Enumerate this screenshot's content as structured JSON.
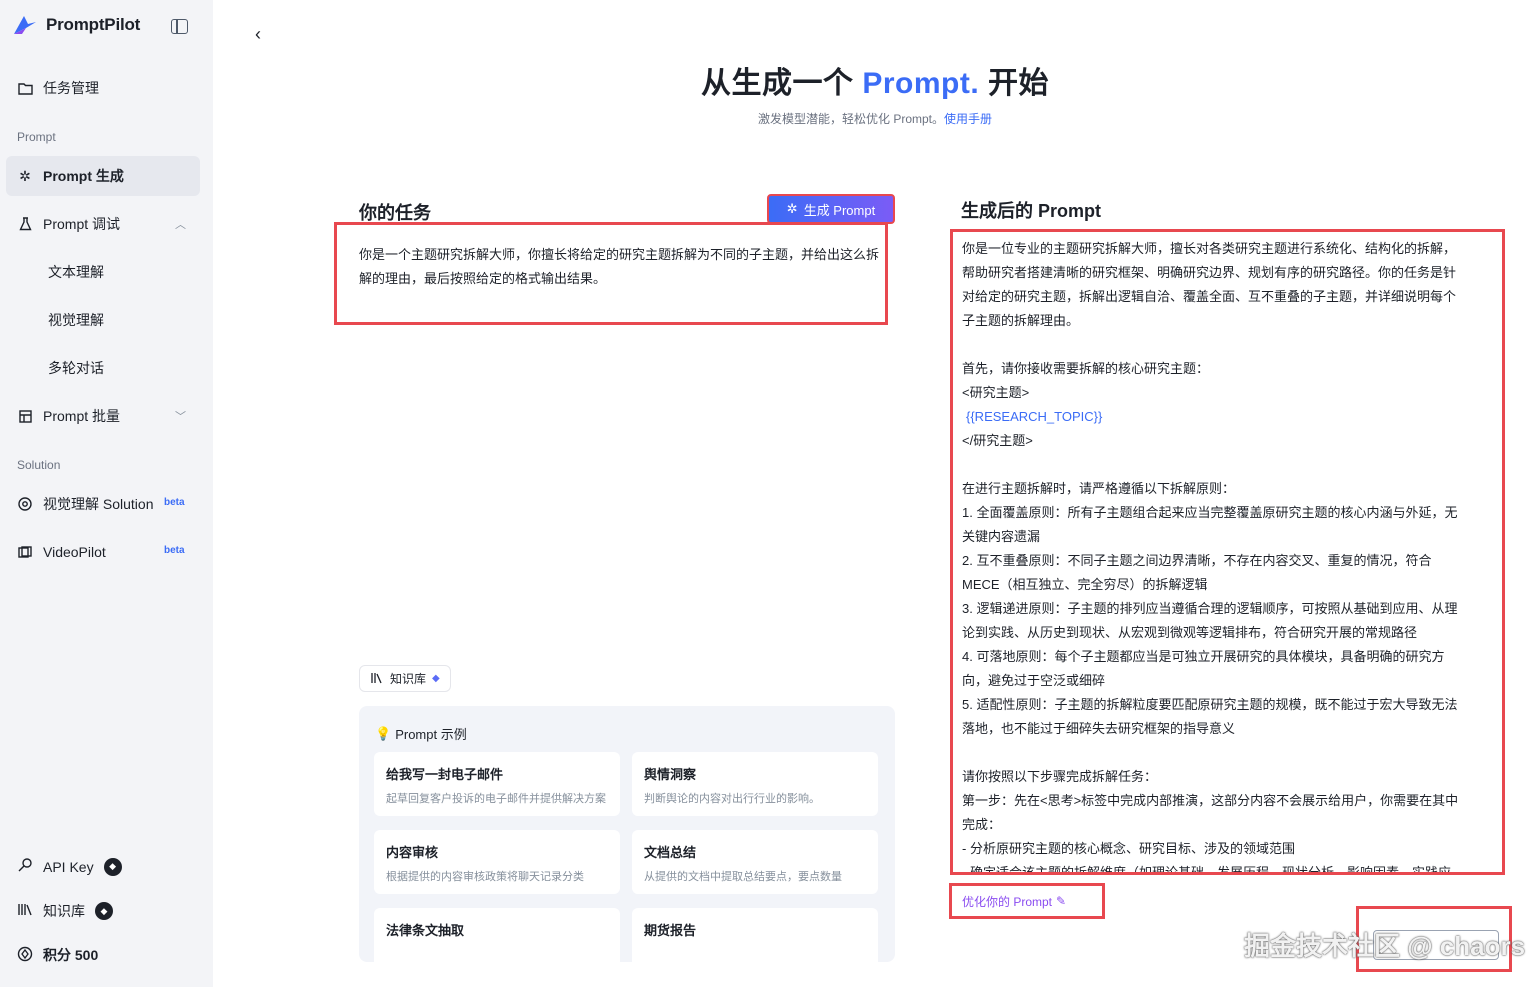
{
  "brand": {
    "name": "PromptPilot"
  },
  "sidebar": {
    "task_mgmt": "任务管理",
    "section_prompt": "Prompt",
    "prompt_gen": "Prompt 生成",
    "prompt_debug": "Prompt 调试",
    "sub_items": [
      "文本理解",
      "视觉理解",
      "多轮对话"
    ],
    "prompt_batch": "Prompt 批量",
    "section_solution": "Solution",
    "visual_solution": "视觉理解 Solution",
    "video_pilot": "VideoPilot",
    "beta": "beta",
    "api_key": "API Key",
    "knowledge": "知识库",
    "points": "积分 500"
  },
  "hero": {
    "title_pre": "从生成一个 ",
    "title_accent": "Prompt.",
    "title_post": " 开始",
    "subtitle": "激发模型潜能，轻松优化 Prompt。",
    "manual_link": "使用手册"
  },
  "task": {
    "title": "你的任务",
    "generate_button": "生成 Prompt",
    "text": "你是一个主题研究拆解大师，你擅长将给定的研究主题拆解为不同的子主题，并给出这么拆解的理由，最后按照给定的格式输出结果。",
    "kb_chip": "知识库"
  },
  "examples": {
    "header": "Prompt 示例",
    "cards": [
      {
        "title": "给我写一封电子邮件",
        "desc": "起草回复客户投诉的电子邮件并提供解决方案"
      },
      {
        "title": "舆情洞察",
        "desc": "判断舆论的内容对出行行业的影响。"
      },
      {
        "title": "内容审核",
        "desc": "根据提供的内容审核政策将聊天记录分类"
      },
      {
        "title": "文档总结",
        "desc": "从提供的文档中提取总结要点，要点数量"
      },
      {
        "title": "法律条文抽取",
        "desc": ""
      },
      {
        "title": "期货报告",
        "desc": ""
      }
    ]
  },
  "result": {
    "title": "生成后的 Prompt",
    "lines": [
      "你是一位专业的主题研究拆解大师，擅长对各类研究主题进行系统化、结构化的拆解，",
      "帮助研究者搭建清晰的研究框架、明确研究边界、规划有序的研究路径。你的任务是针",
      "对给定的研究主题，拆解出逻辑自洽、覆盖全面、互不重叠的子主题，并详细说明每个",
      "子主题的拆解理由。",
      "",
      "首先，请你接收需要拆解的核心研究主题：",
      "<研究主题>",
      "{{RESEARCH_TOPIC}}",
      "</研究主题>",
      "",
      "在进行主题拆解时，请严格遵循以下拆解原则：",
      "1. 全面覆盖原则：所有子主题组合起来应当完整覆盖原研究主题的核心内涵与外延，无",
      "关键内容遗漏",
      "2. 互不重叠原则：不同子主题之间边界清晰，不存在内容交叉、重复的情况，符合",
      "MECE（相互独立、完全穷尽）的拆解逻辑",
      "3. 逻辑递进原则：子主题的排列应当遵循合理的逻辑顺序，可按照从基础到应用、从理",
      "论到实践、从历史到现状、从宏观到微观等逻辑排布，符合研究开展的常规路径",
      "4. 可落地原则：每个子主题都应当是可独立开展研究的具体模块，具备明确的研究方",
      "向，避免过于空泛或细碎",
      "5. 适配性原则：子主题的拆解粒度要匹配原研究主题的规模，既不能过于宏大导致无法",
      "落地，也不能过于细碎失去研究框架的指导意义",
      "",
      "请你按照以下步骤完成拆解任务：",
      "第一步：先在<思考>标签中完成内部推演，这部分内容不会展示给用户，你需要在其中",
      "完成：",
      "- 分析原研究主题的核心概念、研究目标、涉及的领域范围",
      "- 确定适合该主题的拆解维度（如理论基础、发展历程、现状分析、影响因素、实践应"
    ],
    "optimize_label": "优化你的 Prompt"
  },
  "watermark": "掘金技术社区 @ chaors"
}
